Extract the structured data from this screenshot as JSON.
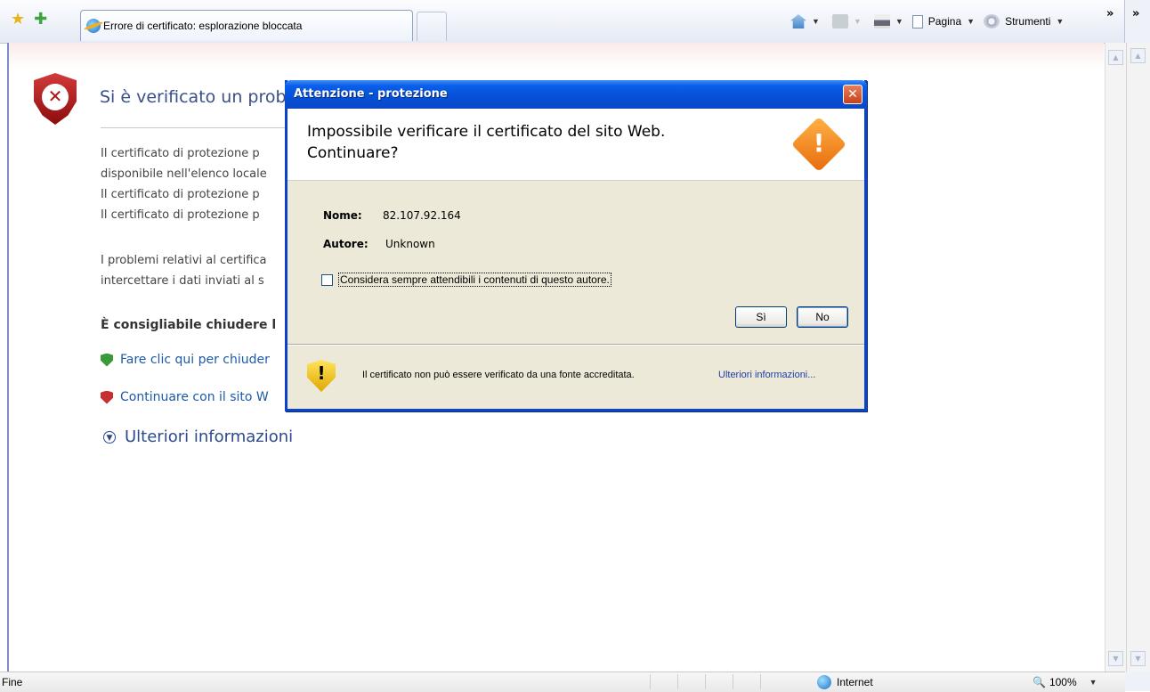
{
  "browser": {
    "tab_title": "Errore di certificato: esplorazione bloccata",
    "page_menu": "Pagina",
    "tools_menu": "Strumenti",
    "overflow_chevron": "»"
  },
  "page": {
    "heading": "Si è verificato un prob",
    "paragraph1_lines": [
      "Il certificato di protezione p",
      "disponibile nell'elenco locale",
      "Il certificato di protezione p",
      "Il certificato di protezione p"
    ],
    "paragraph2_lines": [
      "I problemi relativi al certifica",
      "intercettare i dati inviati al s"
    ],
    "recommendation": "È consigliabile chiudere l",
    "close_link": "Fare clic qui per chiuder",
    "continue_link": "Continuare con il sito W",
    "more_info": "Ulteriori informazioni"
  },
  "dialog": {
    "title": "Attenzione - protezione",
    "close_glyph": "✕",
    "heading_line1": "Impossibile verificare il certificato del sito Web.",
    "heading_line2": "Continuare?",
    "name_label": "Nome:",
    "name_value": "82.107.92.164",
    "author_label": "Autore:",
    "author_value": "Unknown",
    "checkbox_label": "Considera sempre attendibili i contenuti di questo autore.",
    "checkbox_checked": false,
    "yes_button": "Sì",
    "no_button": "No",
    "footer_text": "Il certificato non può essere verificato da una fonte accreditata.",
    "footer_link": "Ulteriori informazioni..."
  },
  "status": {
    "text": "Fine",
    "zone": "Internet",
    "zoom": "100%"
  },
  "icons": {
    "favorites": "star-icon",
    "add_favorites": "add-favorite-icon",
    "home": "home-icon",
    "feeds": "feed-icon",
    "print": "print-icon",
    "page": "page-icon",
    "tools": "gear-icon"
  },
  "colors": {
    "dialog_title_blue": "#0650d6",
    "warning_orange": "#e86a0c",
    "error_red": "#b21414",
    "link_blue": "#1d5aa6"
  }
}
